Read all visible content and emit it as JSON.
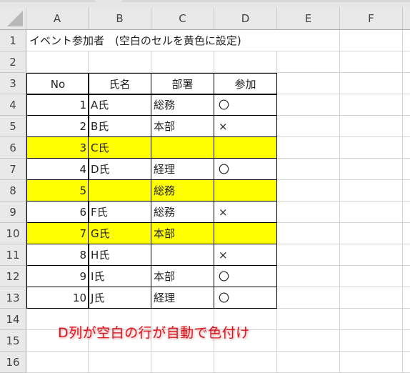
{
  "sheet": {
    "columns": [
      "A",
      "B",
      "C",
      "D",
      "E",
      "F"
    ],
    "rows": [
      "1",
      "2",
      "3",
      "4",
      "5",
      "6",
      "7",
      "8",
      "9",
      "10",
      "11",
      "12",
      "13",
      "14",
      "15",
      "16"
    ],
    "title": "イベント参加者　(空白のセルを黄色に設定)",
    "highlight_color": "#ffff00",
    "table": {
      "headers": [
        "No",
        "氏名",
        "部署",
        "参加"
      ],
      "rows": [
        {
          "no": "1",
          "name": "A氏",
          "dept": "総務",
          "attend": "〇",
          "highlight": false
        },
        {
          "no": "2",
          "name": "B氏",
          "dept": "本部",
          "attend": "×",
          "highlight": false
        },
        {
          "no": "3",
          "name": "C氏",
          "dept": "",
          "attend": "",
          "highlight": true
        },
        {
          "no": "4",
          "name": "D氏",
          "dept": "経理",
          "attend": "〇",
          "highlight": false
        },
        {
          "no": "5",
          "name": "",
          "dept": "総務",
          "attend": "",
          "highlight": true
        },
        {
          "no": "6",
          "name": "F氏",
          "dept": "総務",
          "attend": "×",
          "highlight": false
        },
        {
          "no": "7",
          "name": "G氏",
          "dept": "本部",
          "attend": "",
          "highlight": true
        },
        {
          "no": "8",
          "name": "H氏",
          "dept": "",
          "attend": "×",
          "highlight": false
        },
        {
          "no": "9",
          "name": "I氏",
          "dept": "本部",
          "attend": "〇",
          "highlight": false
        },
        {
          "no": "10",
          "name": "J氏",
          "dept": "経理",
          "attend": "〇",
          "highlight": false
        }
      ]
    }
  },
  "annotation": {
    "text": "D列が空白の行が自動で色付け",
    "color": "#e0141e"
  }
}
